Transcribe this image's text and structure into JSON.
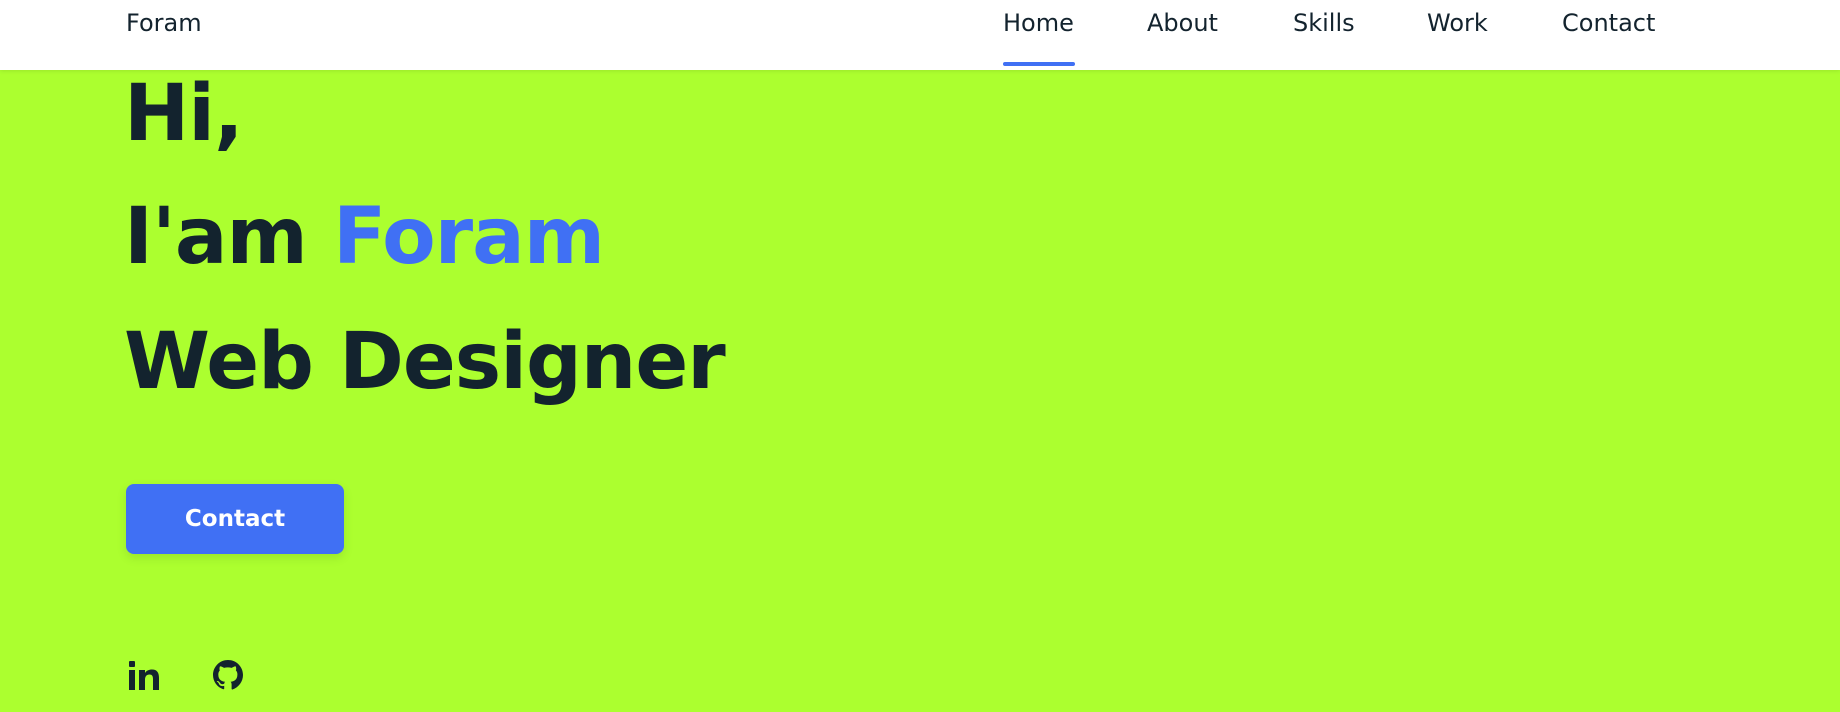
{
  "header": {
    "logo": "Foram",
    "nav": [
      {
        "label": "Home",
        "active": true
      },
      {
        "label": "About",
        "active": false
      },
      {
        "label": "Skills",
        "active": false
      },
      {
        "label": "Work",
        "active": false
      },
      {
        "label": "Contact",
        "active": false
      }
    ]
  },
  "hero": {
    "greeting": "Hi,",
    "intro_prefix": "I'am",
    "name": "Foram",
    "role": "Web Designer",
    "cta_label": "Contact",
    "social": [
      {
        "name": "linkedin-icon"
      },
      {
        "name": "github-icon"
      }
    ]
  },
  "colors": {
    "accent": "#4070f4",
    "hero_background": "#acff2f",
    "text_dark": "#13232e",
    "header_background": "#ffffff"
  }
}
